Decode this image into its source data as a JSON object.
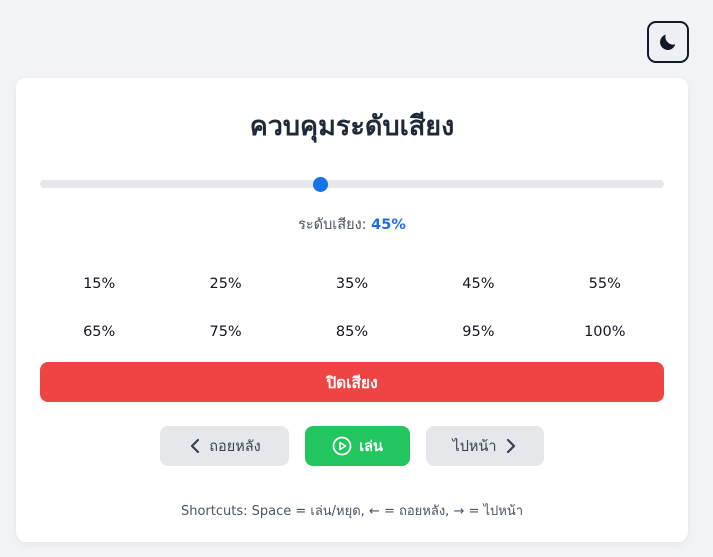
{
  "theme_toggle": {
    "icon": "moon-icon"
  },
  "card": {
    "title": "ควบคุมระดับเสียง",
    "volume": {
      "fraction": 0.45,
      "label": "ระดับเสียง:",
      "value_text": "45%",
      "accent_color": "#1473e6"
    },
    "presets": [
      "15%",
      "25%",
      "35%",
      "45%",
      "55%",
      "65%",
      "75%",
      "85%",
      "95%",
      "100%"
    ],
    "mute_label": "ปิดเสียง",
    "mute_color": "#ef4444",
    "nav": {
      "back_label": "ถอยหลัง",
      "back_icon": "chevron-left-icon",
      "play_label": "เล่น",
      "play_icon": "play-circle-icon",
      "play_color": "#22c55e",
      "next_label": "ไปหน้า",
      "next_icon": "chevron-right-icon"
    },
    "shortcuts": "Shortcuts: Space = เล่น/หยุด, ← = ถอยหลัง, → = ไปหน้า"
  }
}
